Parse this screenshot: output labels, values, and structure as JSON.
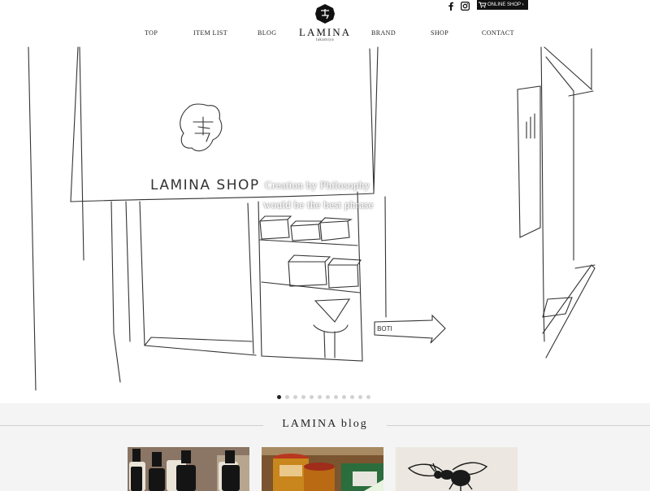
{
  "nav": {
    "left": [
      "TOP",
      "ITEM LIST",
      "BLOG"
    ],
    "right": [
      "BRAND",
      "SHOP",
      "CONTACT"
    ]
  },
  "logo": {
    "name": "LAMINA",
    "sub": "takamiya"
  },
  "social": {
    "facebook_icon": "facebook-icon",
    "instagram_icon": "instagram-icon"
  },
  "online_shop": {
    "label": "ONLINE SHOP ›",
    "icon": "cart-icon"
  },
  "hero": {
    "caption_line1": "Creation by Philosophy",
    "caption_line2": "would be the best phrase",
    "sign_text": "LAMINA SHOP",
    "arrow_text": "BOTI",
    "dot_count": 12,
    "active_dot": 0
  },
  "blog": {
    "title": "LAMINA blog",
    "thumbnails": [
      "bottles-photo",
      "jars-photo",
      "bee-illustration"
    ]
  },
  "colors": {
    "accent": "#111111",
    "background": "#ffffff",
    "section_bg": "#f4f4f4"
  }
}
